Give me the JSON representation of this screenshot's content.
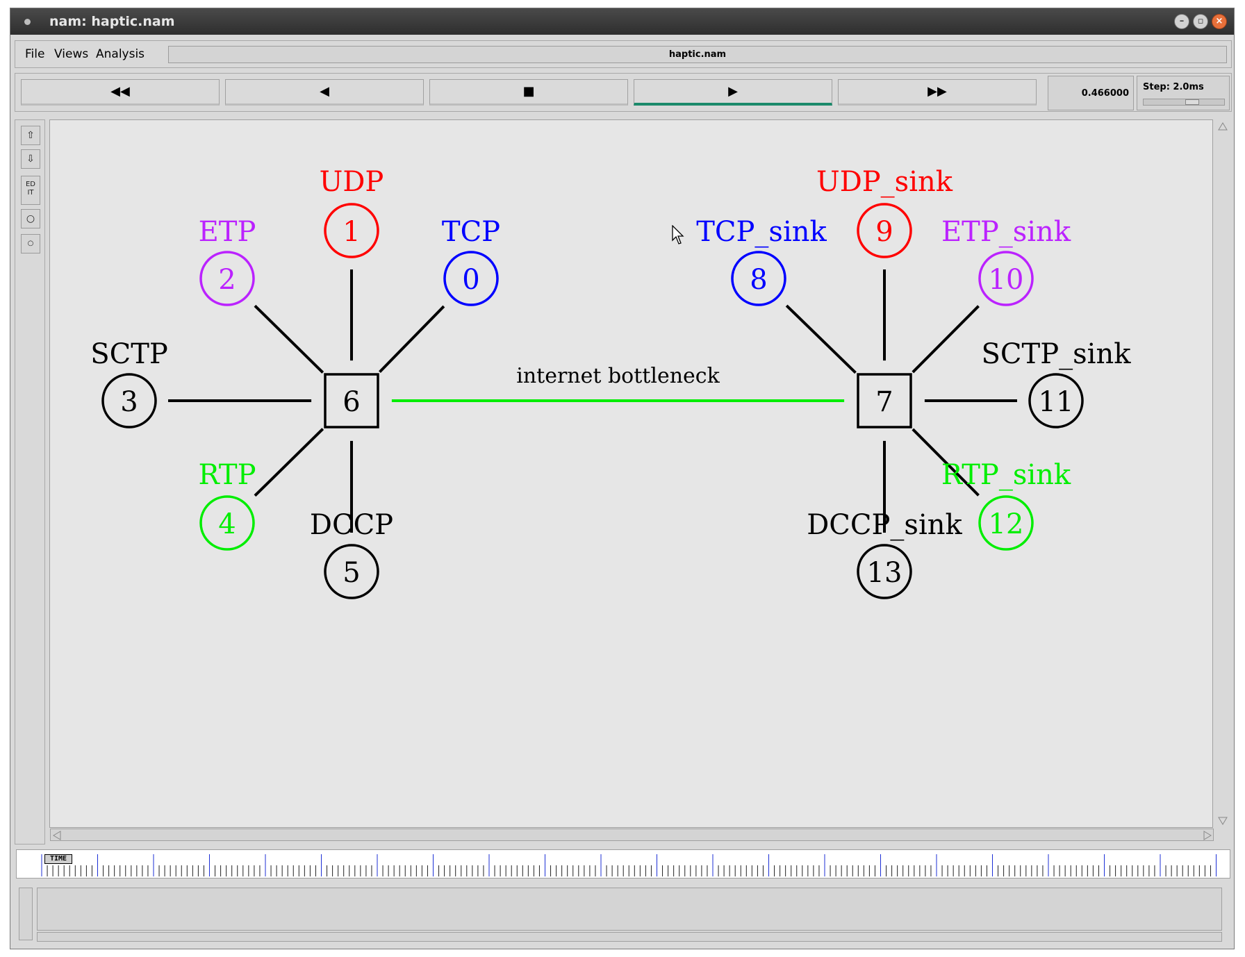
{
  "window": {
    "title": "nam: haptic.nam"
  },
  "menu": {
    "items": [
      {
        "label": "File"
      },
      {
        "label": "Views"
      },
      {
        "label": "Analysis"
      }
    ],
    "file_title": "haptic.nam"
  },
  "toolbar": {
    "buttons": [
      {
        "name": "fast-rewind",
        "glyph": "◀◀"
      },
      {
        "name": "rewind",
        "glyph": "◀"
      },
      {
        "name": "stop",
        "glyph": "■"
      },
      {
        "name": "play",
        "glyph": "▶"
      },
      {
        "name": "fast-forward",
        "glyph": "▶▶"
      }
    ],
    "active_button": "play",
    "time": "0.466000",
    "step_label": "Step: 2.0ms"
  },
  "left_tools": {
    "edit_label": "ED\nIT"
  },
  "timeline": {
    "tag": "TIME"
  },
  "topology": {
    "colors": {
      "red": "#ff0000",
      "blue": "#0000ff",
      "purple": "#bb22ff",
      "green": "#00ee00",
      "black": "#000000",
      "bottleneck": "#00ee00"
    },
    "nodes": [
      {
        "id": "0",
        "label": "TCP",
        "color": "blue",
        "shape": "circle"
      },
      {
        "id": "1",
        "label": "UDP",
        "color": "red",
        "shape": "circle"
      },
      {
        "id": "2",
        "label": "ETP",
        "color": "purple",
        "shape": "circle"
      },
      {
        "id": "3",
        "label": "SCTP",
        "color": "black",
        "shape": "circle"
      },
      {
        "id": "4",
        "label": "RTP",
        "color": "green",
        "shape": "circle"
      },
      {
        "id": "5",
        "label": "DCCP",
        "color": "black",
        "shape": "circle"
      },
      {
        "id": "6",
        "label": "",
        "color": "black",
        "shape": "square"
      },
      {
        "id": "7",
        "label": "",
        "color": "black",
        "shape": "square"
      },
      {
        "id": "8",
        "label": "TCP_sink",
        "color": "blue",
        "shape": "circle"
      },
      {
        "id": "9",
        "label": "UDP_sink",
        "color": "red",
        "shape": "circle"
      },
      {
        "id": "10",
        "label": "ETP_sink",
        "color": "purple",
        "shape": "circle"
      },
      {
        "id": "11",
        "label": "SCTP_sink",
        "color": "black",
        "shape": "circle"
      },
      {
        "id": "12",
        "label": "RTP_sink",
        "color": "green",
        "shape": "circle"
      },
      {
        "id": "13",
        "label": "DCCP_sink",
        "color": "black",
        "shape": "circle"
      }
    ],
    "links": [
      {
        "from": "0",
        "to": "6"
      },
      {
        "from": "1",
        "to": "6"
      },
      {
        "from": "2",
        "to": "6"
      },
      {
        "from": "3",
        "to": "6"
      },
      {
        "from": "4",
        "to": "6"
      },
      {
        "from": "5",
        "to": "6"
      },
      {
        "from": "6",
        "to": "7",
        "label": "internet bottleneck",
        "color": "bottleneck"
      },
      {
        "from": "7",
        "to": "8"
      },
      {
        "from": "7",
        "to": "9"
      },
      {
        "from": "7",
        "to": "10"
      },
      {
        "from": "7",
        "to": "11"
      },
      {
        "from": "7",
        "to": "12"
      },
      {
        "from": "7",
        "to": "13"
      }
    ]
  }
}
